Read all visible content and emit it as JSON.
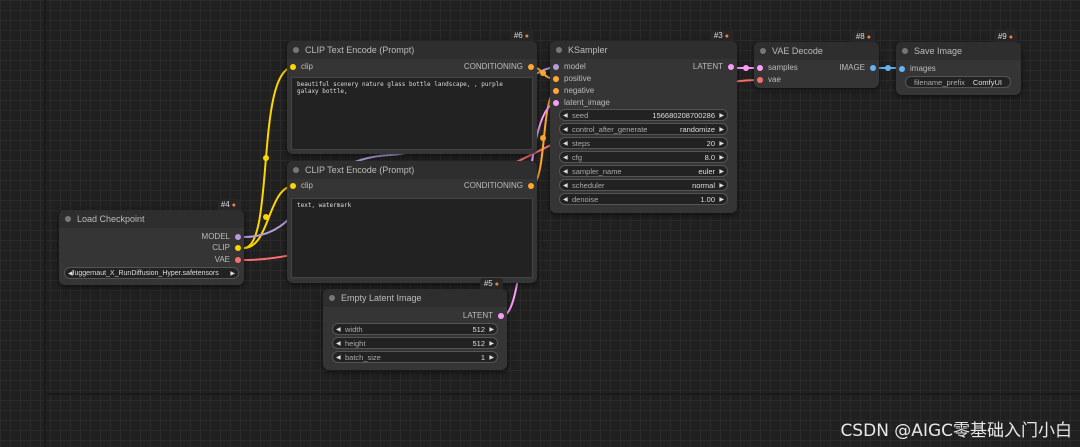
{
  "colors": {
    "model": "#b39ddb",
    "clip": "#ffd500",
    "vae": "#ff6e6e",
    "conditioning": "#ffa931",
    "latent": "#ff9cf9",
    "image": "#64b5f6",
    "background": "#202020",
    "node_body": "#353535",
    "node_title": "#2e2e2e"
  },
  "nodes": {
    "load_checkpoint": {
      "id": "#4",
      "title": "Load Checkpoint",
      "outputs": [
        "MODEL",
        "CLIP",
        "VAE"
      ],
      "ckpt_value": "Juggernaut_X_RunDiffusion_Hyper.safetensors"
    },
    "clip_pos": {
      "id": "#6",
      "title": "CLIP Text Encode (Prompt)",
      "input": "clip",
      "output": "CONDITIONING",
      "text": "beautiful scenery nature glass bottle landscape, , purple galaxy bottle,"
    },
    "clip_neg": {
      "id": "#7",
      "title": "CLIP Text Encode (Prompt)",
      "input": "clip",
      "output": "CONDITIONING",
      "text": "text, watermark"
    },
    "ksampler": {
      "id": "#3",
      "title": "KSampler",
      "inputs": [
        "model",
        "positive",
        "negative",
        "latent_image"
      ],
      "output": "LATENT",
      "widgets": [
        {
          "label": "seed",
          "value": "156680208700286"
        },
        {
          "label": "control_after_generate",
          "value": "randomize"
        },
        {
          "label": "steps",
          "value": "20"
        },
        {
          "label": "cfg",
          "value": "8.0"
        },
        {
          "label": "sampler_name",
          "value": "euler"
        },
        {
          "label": "scheduler",
          "value": "normal"
        },
        {
          "label": "denoise",
          "value": "1.00"
        }
      ]
    },
    "empty_latent": {
      "id": "#5",
      "title": "Empty Latent Image",
      "output": "LATENT",
      "widgets": [
        {
          "label": "width",
          "value": "512"
        },
        {
          "label": "height",
          "value": "512"
        },
        {
          "label": "batch_size",
          "value": "1"
        }
      ]
    },
    "vae_decode": {
      "id": "#8",
      "title": "VAE Decode",
      "inputs": [
        "samples",
        "vae"
      ],
      "output": "IMAGE"
    },
    "save_image": {
      "id": "#9",
      "title": "Save Image",
      "input": "images",
      "widget": {
        "label": "filename_prefix",
        "value": "ComfyUI"
      }
    }
  },
  "icons": {
    "badge": "fox-icon",
    "arrow_left": "arrow-left-icon",
    "arrow_right": "arrow-right-icon"
  },
  "watermark": "CSDN @AIGC零基础入门小白"
}
